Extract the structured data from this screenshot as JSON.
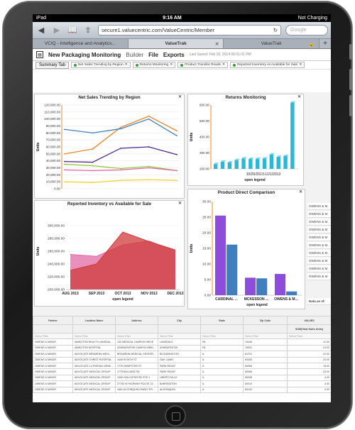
{
  "status": {
    "carrier": "iPad",
    "time": "9:16 AM",
    "battery": "Not Charging"
  },
  "browser": {
    "url": "secure1.valuecentric.com/ValueCentric/Member",
    "search_placeholder": "Google",
    "tabs": [
      {
        "label": "VCIQ - Intelligence and Analytics..."
      },
      {
        "label": "ValueTrak"
      },
      {
        "label": "ValueTrak"
      }
    ]
  },
  "app": {
    "title": "New Packaging Monitoring",
    "menu": [
      "Builder",
      "File",
      "Exports"
    ],
    "saved": "Last Saved: Feb 19, 2014 09:01:01 PM"
  },
  "filters": {
    "summary_tab": "Summary Tab",
    "chips": [
      "Net Sales Trending by Region",
      "Returns Monitoring",
      "Product Transfer Reads",
      "Reported Inventory vs Available for Sale"
    ]
  },
  "colors": {
    "orange": "#f0862a",
    "blue": "#3f7fc0",
    "purple": "#4b2a8c",
    "green": "#96c83c",
    "yellow": "#f2d12e",
    "pink": "#e06aa6",
    "red": "#d03b3b",
    "cyan": "#2bb8d6",
    "violet": "#8d4cd9"
  },
  "chart_data": [
    {
      "type": "line",
      "title": "Net Sales Trending by Region",
      "ylabel": "Units",
      "ylim": [
        0,
        120000
      ],
      "yticks": [
        "0.00",
        "10,000.00",
        "20,000.00",
        "30,000.00",
        "40,000.00",
        "50,000.00",
        "60,000.00",
        "70,000.00",
        "80,000.00",
        "90,000.00",
        "100,000.00",
        "110,000.00",
        "120,000.00"
      ],
      "series": [
        {
          "color": "#f0862a",
          "values": [
            50000,
            57000,
            88000,
            104000,
            83000
          ]
        },
        {
          "color": "#3f7fc0",
          "values": [
            85000,
            80000,
            86000,
            100000,
            76000
          ]
        },
        {
          "color": "#4b2a8c",
          "values": [
            39000,
            38000,
            58000,
            60000,
            49000
          ]
        },
        {
          "color": "#96c83c",
          "values": [
            35000,
            33000,
            29000,
            32000,
            26000
          ]
        },
        {
          "color": "#e06aa6",
          "values": [
            27000,
            26000,
            27000,
            30000,
            26000
          ]
        },
        {
          "color": "#f2d12e",
          "values": [
            10000,
            9000,
            12000,
            13000,
            12000
          ]
        }
      ]
    },
    {
      "type": "bar",
      "title": "Returns Monitoring",
      "ylabel": "Units",
      "xlabel": "10/26/2013-11/1/2013",
      "legend": "open legend",
      "ylim": [
        200,
        600
      ],
      "yticks": [
        "200.00",
        "300.00",
        "400.00",
        "500.00",
        "600.00"
      ],
      "values": [
        230,
        245,
        240,
        255,
        265,
        262,
        262,
        265,
        290,
        275,
        280,
        615
      ]
    },
    {
      "type": "area",
      "title": "Reported Inventory vs Available for Sale",
      "ylabel": "Units",
      "legend": "open legend",
      "categories": [
        "AUG 2013",
        "SEP 2013",
        "OCT 2013",
        "NOV 2013",
        "DEC 2013"
      ],
      "ylim": [
        200000,
        320000
      ],
      "yticks": [
        "200,000.00",
        "220,000.00",
        "240,000.00",
        "260,000.00",
        "280,000.00",
        "300,000.00"
      ],
      "series": [
        {
          "color": "#e06aa6",
          "values": [
            255000,
            252000,
            270000,
            276000,
            260000
          ]
        },
        {
          "color": "#d03b3b",
          "values": [
            230000,
            240000,
            290000,
            275000,
            262000
          ]
        }
      ]
    },
    {
      "type": "bar",
      "title": "Product Direct Comparison",
      "ylabel": "Units",
      "legend": "open legend",
      "categories": [
        "CARDINAL ...",
        "MCKESSON ...",
        "OWENS & M..."
      ],
      "ylim": [
        0,
        30
      ],
      "yticks": [
        "0.00",
        "5.00",
        "10.00",
        "15.00",
        "20.00",
        "25.00",
        "30.00"
      ],
      "series": [
        {
          "color": "#8d4cd9",
          "values": [
            25.5,
            5.6,
            6.8
          ]
        },
        {
          "color": "#3f7fc0",
          "values": [
            16.2,
            5.4,
            1.2
          ]
        }
      ]
    }
  ],
  "side_list": {
    "items": [
      "OWENS & M",
      "OWENS & M",
      "OWENS & M",
      "OWENS & M",
      "OWENS & M",
      "OWENS & M",
      "OWENS & M",
      "OWENS & M",
      "OWENS & M",
      "OWENS & M"
    ],
    "footer": "Data as of:"
  },
  "table": {
    "headers": [
      "Partner",
      "Location Name",
      "Address",
      "City",
      "State",
      "Zip Code",
      "VALUES"
    ],
    "subheader": "SUM(Total Sales Units)",
    "filter_label": "Select Filter",
    "rows": [
      [
        "OWENS & MINOR",
        "ABINGTON HEALTH LANSDALE HOSP",
        "100 MEDICAL CAMPUS DRIVE",
        "LANSDALE",
        "PA",
        "19446",
        "12.00"
      ],
      [
        "OWENS & MINOR",
        "ABINGTON HOSPITAL",
        "ASHBURNTON CAMPUS ABINGTON HOSPITAL",
        "ASHBURNTON",
        "PA",
        "19001",
        "24.00"
      ],
      [
        "OWENS & MINOR",
        "ADVOCATE BROMENN MEDICAL CENTER",
        "BROMENN MEDICAL CENTER 1015 LAFAYETTE STREET",
        "BLOOMINGTON",
        "IL",
        "61701",
        "22.00"
      ],
      [
        "OWENS & MINOR",
        "ADVOCATE CHRIST HOSPITAL",
        "4440 W 95TH ST",
        "OAK LAWN",
        "IL",
        "60453",
        "24.00"
      ],
      [
        "OWENS & MINOR",
        "ADVOCATE LUTHERAN GENERAL HOSPITAL",
        "1775 DEMPSTER ST",
        "PARK RIDGE",
        "IL",
        "60068",
        "18.00"
      ],
      [
        "OWENS & MINOR",
        "ADVOCATE MEDICAL GROUP",
        "1775 BALLARD RD",
        "PARK RIDGE",
        "IL",
        "60068",
        "24.00"
      ],
      [
        "OWENS & MINOR",
        "ADVOCATE MEDICAL GROUP",
        "1000 HOLLISTER RD STE 1",
        "LIBERTYVILLE",
        "IL",
        "60048",
        "4.00"
      ],
      [
        "OWENS & MINOR",
        "ADVOCATE MEDICAL GROUP",
        "27750 W HIGHWAY ROUTE 22 STE 1",
        "BARRINGTON",
        "IL",
        "60010",
        "4.00"
      ],
      [
        "OWENS & MINOR",
        "ADVOCATE MEDICAL GROUP",
        "1661 ALGONQUIN FAMILY PRACTICE 1924 COUNTY LINE ROAD",
        "ALGONQUIN",
        "IL",
        "60102",
        "4.00"
      ]
    ]
  }
}
